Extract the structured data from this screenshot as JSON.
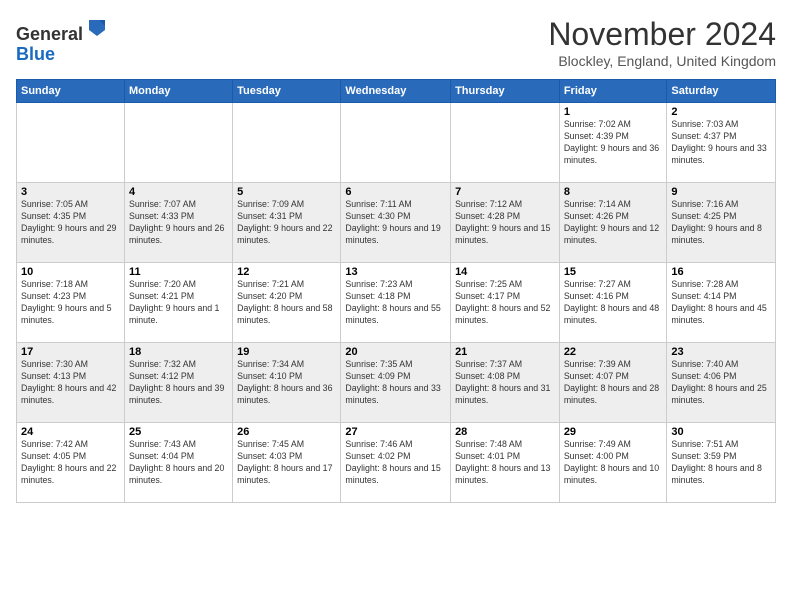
{
  "header": {
    "logo_line1": "General",
    "logo_line2": "Blue",
    "month_title": "November 2024",
    "location": "Blockley, England, United Kingdom"
  },
  "weekdays": [
    "Sunday",
    "Monday",
    "Tuesday",
    "Wednesday",
    "Thursday",
    "Friday",
    "Saturday"
  ],
  "weeks": [
    [
      {
        "day": "",
        "sunrise": "",
        "sunset": "",
        "daylight": ""
      },
      {
        "day": "",
        "sunrise": "",
        "sunset": "",
        "daylight": ""
      },
      {
        "day": "",
        "sunrise": "",
        "sunset": "",
        "daylight": ""
      },
      {
        "day": "",
        "sunrise": "",
        "sunset": "",
        "daylight": ""
      },
      {
        "day": "",
        "sunrise": "",
        "sunset": "",
        "daylight": ""
      },
      {
        "day": "1",
        "sunrise": "Sunrise: 7:02 AM",
        "sunset": "Sunset: 4:39 PM",
        "daylight": "Daylight: 9 hours and 36 minutes."
      },
      {
        "day": "2",
        "sunrise": "Sunrise: 7:03 AM",
        "sunset": "Sunset: 4:37 PM",
        "daylight": "Daylight: 9 hours and 33 minutes."
      }
    ],
    [
      {
        "day": "3",
        "sunrise": "Sunrise: 7:05 AM",
        "sunset": "Sunset: 4:35 PM",
        "daylight": "Daylight: 9 hours and 29 minutes."
      },
      {
        "day": "4",
        "sunrise": "Sunrise: 7:07 AM",
        "sunset": "Sunset: 4:33 PM",
        "daylight": "Daylight: 9 hours and 26 minutes."
      },
      {
        "day": "5",
        "sunrise": "Sunrise: 7:09 AM",
        "sunset": "Sunset: 4:31 PM",
        "daylight": "Daylight: 9 hours and 22 minutes."
      },
      {
        "day": "6",
        "sunrise": "Sunrise: 7:11 AM",
        "sunset": "Sunset: 4:30 PM",
        "daylight": "Daylight: 9 hours and 19 minutes."
      },
      {
        "day": "7",
        "sunrise": "Sunrise: 7:12 AM",
        "sunset": "Sunset: 4:28 PM",
        "daylight": "Daylight: 9 hours and 15 minutes."
      },
      {
        "day": "8",
        "sunrise": "Sunrise: 7:14 AM",
        "sunset": "Sunset: 4:26 PM",
        "daylight": "Daylight: 9 hours and 12 minutes."
      },
      {
        "day": "9",
        "sunrise": "Sunrise: 7:16 AM",
        "sunset": "Sunset: 4:25 PM",
        "daylight": "Daylight: 9 hours and 8 minutes."
      }
    ],
    [
      {
        "day": "10",
        "sunrise": "Sunrise: 7:18 AM",
        "sunset": "Sunset: 4:23 PM",
        "daylight": "Daylight: 9 hours and 5 minutes."
      },
      {
        "day": "11",
        "sunrise": "Sunrise: 7:20 AM",
        "sunset": "Sunset: 4:21 PM",
        "daylight": "Daylight: 9 hours and 1 minute."
      },
      {
        "day": "12",
        "sunrise": "Sunrise: 7:21 AM",
        "sunset": "Sunset: 4:20 PM",
        "daylight": "Daylight: 8 hours and 58 minutes."
      },
      {
        "day": "13",
        "sunrise": "Sunrise: 7:23 AM",
        "sunset": "Sunset: 4:18 PM",
        "daylight": "Daylight: 8 hours and 55 minutes."
      },
      {
        "day": "14",
        "sunrise": "Sunrise: 7:25 AM",
        "sunset": "Sunset: 4:17 PM",
        "daylight": "Daylight: 8 hours and 52 minutes."
      },
      {
        "day": "15",
        "sunrise": "Sunrise: 7:27 AM",
        "sunset": "Sunset: 4:16 PM",
        "daylight": "Daylight: 8 hours and 48 minutes."
      },
      {
        "day": "16",
        "sunrise": "Sunrise: 7:28 AM",
        "sunset": "Sunset: 4:14 PM",
        "daylight": "Daylight: 8 hours and 45 minutes."
      }
    ],
    [
      {
        "day": "17",
        "sunrise": "Sunrise: 7:30 AM",
        "sunset": "Sunset: 4:13 PM",
        "daylight": "Daylight: 8 hours and 42 minutes."
      },
      {
        "day": "18",
        "sunrise": "Sunrise: 7:32 AM",
        "sunset": "Sunset: 4:12 PM",
        "daylight": "Daylight: 8 hours and 39 minutes."
      },
      {
        "day": "19",
        "sunrise": "Sunrise: 7:34 AM",
        "sunset": "Sunset: 4:10 PM",
        "daylight": "Daylight: 8 hours and 36 minutes."
      },
      {
        "day": "20",
        "sunrise": "Sunrise: 7:35 AM",
        "sunset": "Sunset: 4:09 PM",
        "daylight": "Daylight: 8 hours and 33 minutes."
      },
      {
        "day": "21",
        "sunrise": "Sunrise: 7:37 AM",
        "sunset": "Sunset: 4:08 PM",
        "daylight": "Daylight: 8 hours and 31 minutes."
      },
      {
        "day": "22",
        "sunrise": "Sunrise: 7:39 AM",
        "sunset": "Sunset: 4:07 PM",
        "daylight": "Daylight: 8 hours and 28 minutes."
      },
      {
        "day": "23",
        "sunrise": "Sunrise: 7:40 AM",
        "sunset": "Sunset: 4:06 PM",
        "daylight": "Daylight: 8 hours and 25 minutes."
      }
    ],
    [
      {
        "day": "24",
        "sunrise": "Sunrise: 7:42 AM",
        "sunset": "Sunset: 4:05 PM",
        "daylight": "Daylight: 8 hours and 22 minutes."
      },
      {
        "day": "25",
        "sunrise": "Sunrise: 7:43 AM",
        "sunset": "Sunset: 4:04 PM",
        "daylight": "Daylight: 8 hours and 20 minutes."
      },
      {
        "day": "26",
        "sunrise": "Sunrise: 7:45 AM",
        "sunset": "Sunset: 4:03 PM",
        "daylight": "Daylight: 8 hours and 17 minutes."
      },
      {
        "day": "27",
        "sunrise": "Sunrise: 7:46 AM",
        "sunset": "Sunset: 4:02 PM",
        "daylight": "Daylight: 8 hours and 15 minutes."
      },
      {
        "day": "28",
        "sunrise": "Sunrise: 7:48 AM",
        "sunset": "Sunset: 4:01 PM",
        "daylight": "Daylight: 8 hours and 13 minutes."
      },
      {
        "day": "29",
        "sunrise": "Sunrise: 7:49 AM",
        "sunset": "Sunset: 4:00 PM",
        "daylight": "Daylight: 8 hours and 10 minutes."
      },
      {
        "day": "30",
        "sunrise": "Sunrise: 7:51 AM",
        "sunset": "Sunset: 3:59 PM",
        "daylight": "Daylight: 8 hours and 8 minutes."
      }
    ]
  ]
}
